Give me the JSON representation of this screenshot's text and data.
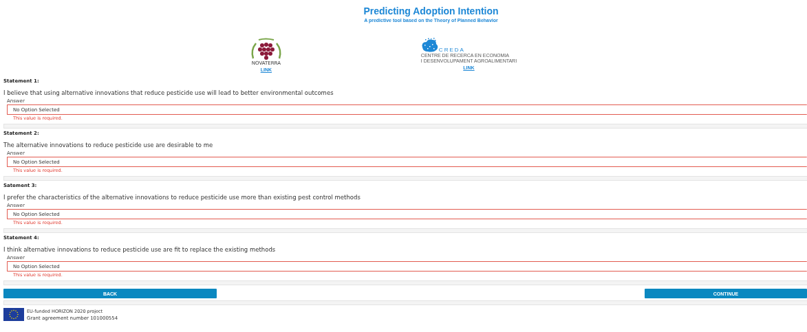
{
  "header": {
    "title": "Predicting Adoption Intention",
    "subtitle": "A predictive tool based on the Theory of Planned Behavior"
  },
  "partners": [
    {
      "kind": "novaterra",
      "name": "NOVATERRA",
      "link": "LINK"
    },
    {
      "kind": "creda",
      "name": "CREDA",
      "caption": [
        "CENTRE DE RECERCA EN ECONOMIA",
        "I DESENVOLUPAMENT AGROALIMENTARI"
      ],
      "link": "LINK"
    }
  ],
  "statements": [
    {
      "label": "Statement 1:",
      "text": "I believe that using alternative innovations that reduce pesticide use will lead to better environmental outcomes",
      "answer_label": "Answer",
      "value": "No Option Selected",
      "error": "This value is required."
    },
    {
      "label": "Statement 2:",
      "text": "The alternative innovations to reduce pesticide use are desirable to me",
      "answer_label": "Answer",
      "value": "No Option Selected",
      "error": "This value is required."
    },
    {
      "label": "Satement 3:",
      "text": "I prefer the characteristics of the alternative innovations to reduce pesticide use more than existing pest control methods",
      "answer_label": "Answer",
      "value": "No Option Selected",
      "error": "This value is required."
    },
    {
      "label": "Statement 4:",
      "text": "I think alternative innovations to reduce pesticide use are fit to replace the existing methods",
      "answer_label": "Answer",
      "value": "No Option Selected",
      "error": "This value is required."
    }
  ],
  "buttons": [
    {
      "label": "BACK"
    },
    {
      "label": "CONTINUE"
    }
  ],
  "footer": {
    "funding": "EU-funded HORIZON 2020 project",
    "grant": "Grant agreement number 101000554"
  }
}
